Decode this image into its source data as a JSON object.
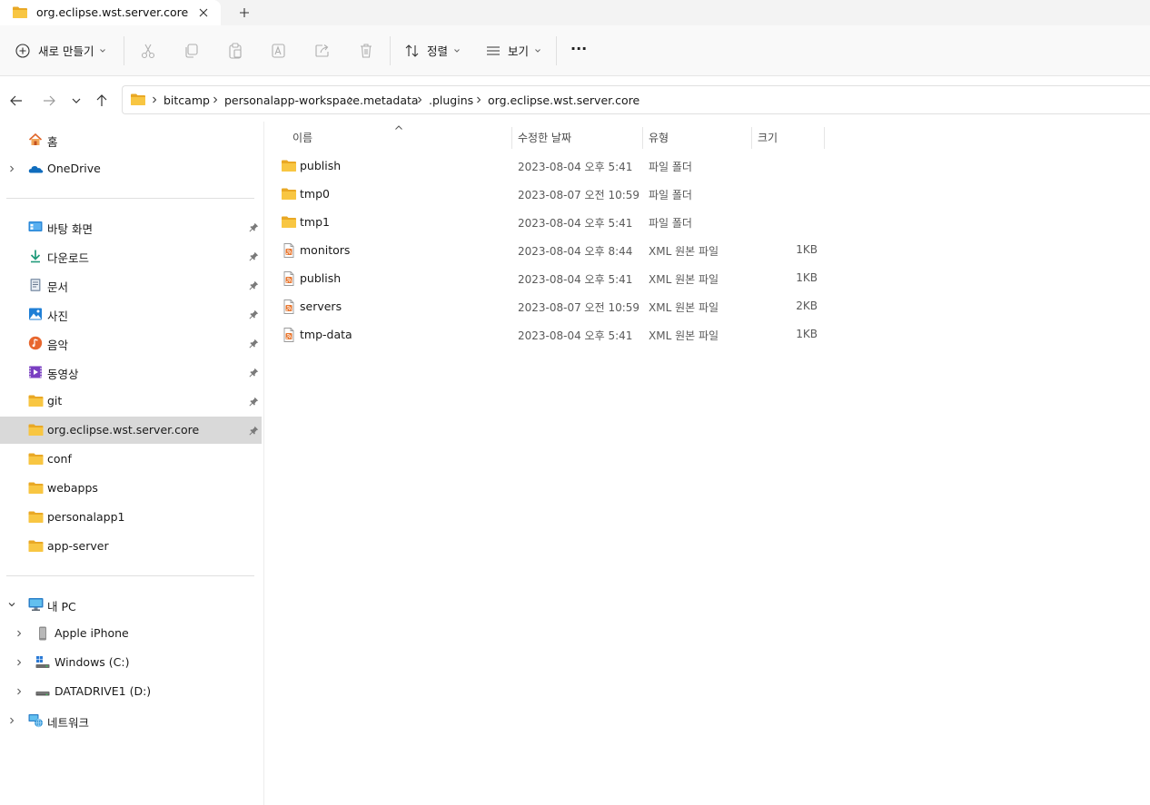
{
  "tab": {
    "title": "org.eclipse.wst.server.core"
  },
  "toolbar": {
    "new_label": "새로 만들기",
    "sort_label": "정렬",
    "view_label": "보기",
    "more_label": "···"
  },
  "breadcrumb": [
    "bitcamp",
    "personalapp-workspace",
    ".metadata",
    ".plugins",
    "org.eclipse.wst.server.core"
  ],
  "sidebar": {
    "top": [
      {
        "label": "홈",
        "icon": "home-icon"
      },
      {
        "label": "OneDrive",
        "icon": "cloud-icon"
      }
    ],
    "quick_access": [
      {
        "label": "바탕 화면",
        "icon": "desktop-icon"
      },
      {
        "label": "다운로드",
        "icon": "download-icon"
      },
      {
        "label": "문서",
        "icon": "document-icon"
      },
      {
        "label": "사진",
        "icon": "pictures-icon"
      },
      {
        "label": "음악",
        "icon": "music-icon"
      },
      {
        "label": "동영상",
        "icon": "video-icon"
      },
      {
        "label": "git",
        "icon": "folder-icon"
      },
      {
        "label": "org.eclipse.wst.server.core",
        "icon": "folder-icon"
      },
      {
        "label": "conf",
        "icon": "folder-icon"
      },
      {
        "label": "webapps",
        "icon": "folder-icon"
      },
      {
        "label": "personalapp1",
        "icon": "folder-icon"
      },
      {
        "label": "app-server",
        "icon": "folder-icon"
      }
    ],
    "this_pc": {
      "label": "내 PC",
      "icon": "computer-icon"
    },
    "devices": [
      {
        "label": "Apple iPhone",
        "icon": "phone-icon"
      },
      {
        "label": "Windows  (C:)",
        "icon": "drive-icon"
      },
      {
        "label": "DATADRIVE1  (D:)",
        "icon": "drive-icon"
      }
    ],
    "network": {
      "label": "네트워크",
      "icon": "network-icon"
    }
  },
  "columns": {
    "name": "이름",
    "date": "수정한 날짜",
    "type": "유형",
    "size": "크기"
  },
  "files": [
    {
      "name": "publish",
      "date": "2023-08-04 오후 5:41",
      "type": "파일 폴더",
      "size": "",
      "kind": "folder"
    },
    {
      "name": "tmp0",
      "date": "2023-08-07 오전 10:59",
      "type": "파일 폴더",
      "size": "",
      "kind": "folder"
    },
    {
      "name": "tmp1",
      "date": "2023-08-04 오후 5:41",
      "type": "파일 폴더",
      "size": "",
      "kind": "folder"
    },
    {
      "name": "monitors",
      "date": "2023-08-04 오후 8:44",
      "type": "XML 원본 파일",
      "size": "1KB",
      "kind": "xml"
    },
    {
      "name": "publish",
      "date": "2023-08-04 오후 5:41",
      "type": "XML 원본 파일",
      "size": "1KB",
      "kind": "xml"
    },
    {
      "name": "servers",
      "date": "2023-08-07 오전 10:59",
      "type": "XML 원본 파일",
      "size": "2KB",
      "kind": "xml"
    },
    {
      "name": "tmp-data",
      "date": "2023-08-04 오후 5:41",
      "type": "XML 원본 파일",
      "size": "1KB",
      "kind": "xml"
    }
  ],
  "colors": {
    "folder": "#f8c642",
    "folder_dark": "#e9a825",
    "selection": "#d9d9d9",
    "accent": "#0067c0"
  }
}
